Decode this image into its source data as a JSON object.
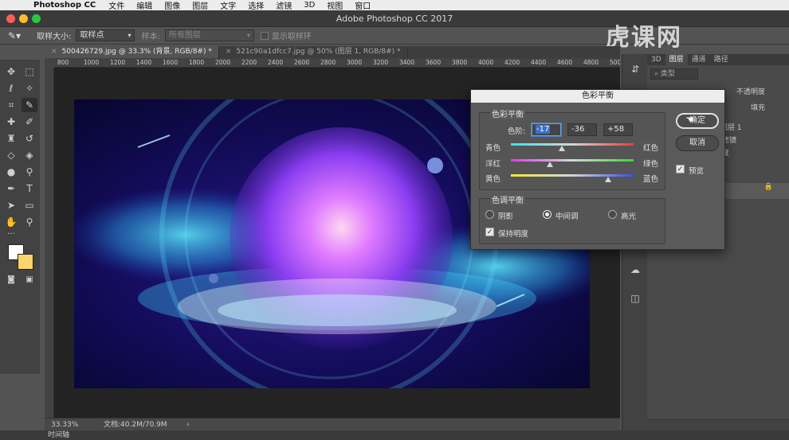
{
  "menubar": {
    "app": "Photoshop CC",
    "items": [
      "文件",
      "编辑",
      "图像",
      "图层",
      "文字",
      "选择",
      "滤镜",
      "3D",
      "视图",
      "窗口"
    ]
  },
  "window": {
    "title": "Adobe Photoshop CC 2017"
  },
  "options": {
    "sample_size_label": "取样大小:",
    "sample_size_value": "取样点",
    "sample_label": "样本:",
    "sample_value": "所有图层",
    "show_ring_label": "显示取样环"
  },
  "watermark": "虎课网",
  "tabs": [
    {
      "label": "500426729.jpg @ 33.3% (背景, RGB/8#) *",
      "active": true
    },
    {
      "label": "521c90a1dfcc7.jpg @ 50% (图层 1, RGB/8#) *",
      "active": false
    }
  ],
  "ruler": [
    "800",
    "1000",
    "1200",
    "1400",
    "1600",
    "1800",
    "2000",
    "2200",
    "2400",
    "2600",
    "2800",
    "3000",
    "3200",
    "3400",
    "3600",
    "3800",
    "4000",
    "4200",
    "4400",
    "4600",
    "4800",
    "5000"
  ],
  "status": {
    "zoom": "33.33%",
    "doc": "文档:40.2M/70.9M",
    "arrow": "›"
  },
  "timeline": "时间轴",
  "panel": {
    "tabs": [
      "3D",
      "图层",
      "通道",
      "路径"
    ],
    "kind_label": "类型",
    "opacity_label": "不透明度",
    "fill_label": "填充",
    "layer1": "图层 1",
    "filter": "滤镜",
    "degree": "度",
    "i_mark": "i"
  },
  "dialog": {
    "title": "色彩平衡",
    "group1_label": "色彩平衡",
    "levels_label": "色阶:",
    "level1": "-17",
    "level2": "-36",
    "level3": "+58",
    "rows": [
      {
        "left": "青色",
        "right": "红色",
        "value": -17
      },
      {
        "left": "洋红",
        "right": "绿色",
        "value": -36
      },
      {
        "left": "黄色",
        "right": "蓝色",
        "value": 58
      }
    ],
    "group2_label": "色调平衡",
    "tones": [
      "阴影",
      "中间调",
      "高光"
    ],
    "selected_tone": "中间调",
    "preserve_label": "保持明度",
    "ok_label": "确定",
    "cancel_label": "取消",
    "preview_label": "预览"
  },
  "colors": {
    "foreground": "#ffffff",
    "background": "#f7d56a"
  }
}
